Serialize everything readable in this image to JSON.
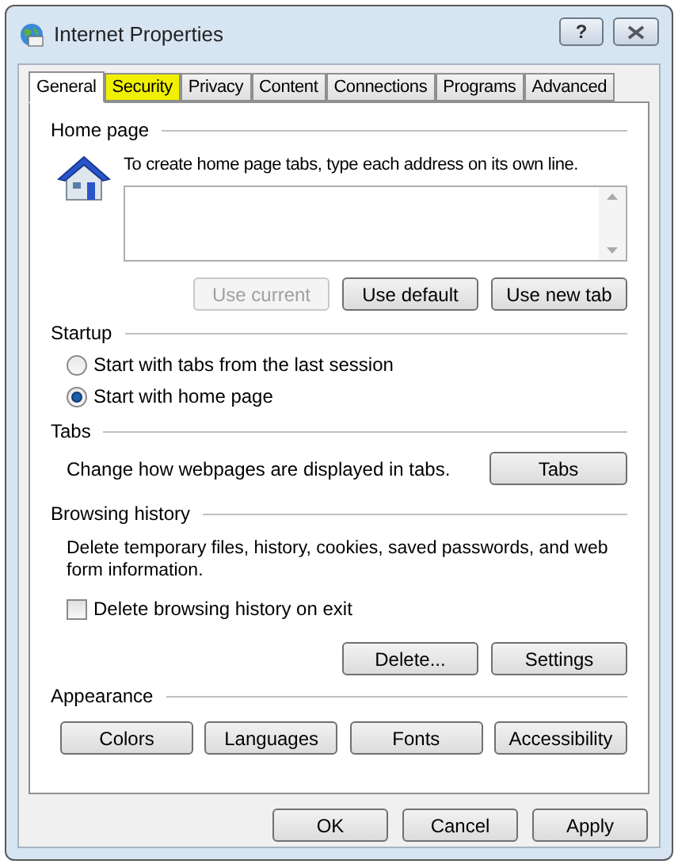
{
  "window": {
    "title": "Internet Properties",
    "help_button": "?"
  },
  "tabs": [
    {
      "label": "General",
      "selected": true,
      "highlighted": false
    },
    {
      "label": "Security",
      "selected": false,
      "highlighted": true
    },
    {
      "label": "Privacy",
      "selected": false,
      "highlighted": false
    },
    {
      "label": "Content",
      "selected": false,
      "highlighted": false
    },
    {
      "label": "Connections",
      "selected": false,
      "highlighted": false
    },
    {
      "label": "Programs",
      "selected": false,
      "highlighted": false
    },
    {
      "label": "Advanced",
      "selected": false,
      "highlighted": false
    }
  ],
  "home_page": {
    "heading": "Home page",
    "instruction": "To create home page tabs, type each address on its own line.",
    "buttons": [
      {
        "label": "Use current",
        "disabled": true
      },
      {
        "label": "Use default",
        "disabled": false
      },
      {
        "label": "Use new tab",
        "disabled": false
      }
    ]
  },
  "startup": {
    "heading": "Startup",
    "options": [
      {
        "label": "Start with tabs from the last session",
        "selected": false
      },
      {
        "label": "Start with home page",
        "selected": true
      }
    ]
  },
  "tabs_section": {
    "heading": "Tabs",
    "description": "Change how webpages are displayed in tabs.",
    "button": "Tabs"
  },
  "browsing_history": {
    "heading": "Browsing history",
    "description": "Delete temporary files, history, cookies, saved passwords, and web form information.",
    "delete_on_exit": {
      "label": "Delete browsing history on exit",
      "checked": false
    },
    "buttons": [
      "Delete...",
      "Settings"
    ]
  },
  "appearance": {
    "heading": "Appearance",
    "buttons": [
      "Colors",
      "Languages",
      "Fonts",
      "Accessibility"
    ]
  },
  "footer_buttons": [
    "OK",
    "Cancel",
    "Apply"
  ]
}
